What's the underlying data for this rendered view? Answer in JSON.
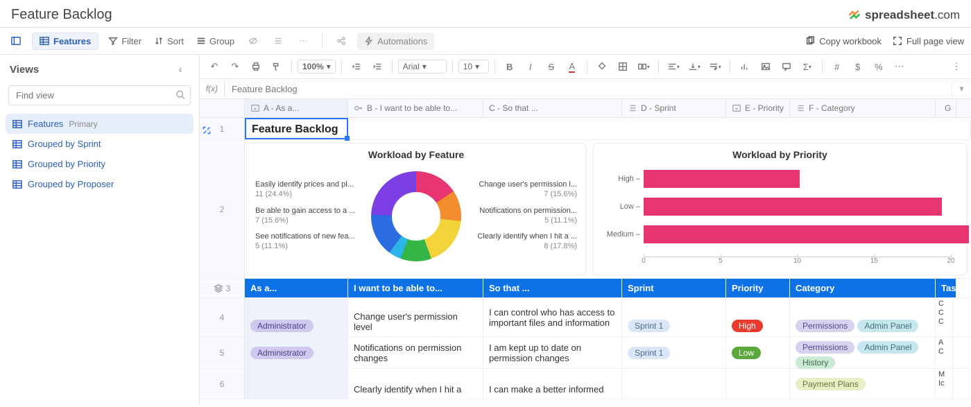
{
  "header": {
    "title": "Feature Backlog",
    "brand_text": "spreadsheet",
    "brand_suffix": ".com",
    "copy_label": "Copy workbook",
    "fullpage_label": "Full page view"
  },
  "toolbar1": {
    "features_tab": "Features",
    "filter": "Filter",
    "sort": "Sort",
    "group": "Group",
    "automations": "Automations"
  },
  "sidebar": {
    "views_label": "Views",
    "search_placeholder": "Find view",
    "items": [
      {
        "label": "Features",
        "primary": "Primary",
        "active": true
      },
      {
        "label": "Grouped by Sprint"
      },
      {
        "label": "Grouped by Priority"
      },
      {
        "label": "Grouped by Proposer"
      }
    ]
  },
  "toolbar2": {
    "zoom": "100%",
    "font": "Arial",
    "size": "10"
  },
  "fx": {
    "label": "f(x)",
    "value": "Feature Backlog"
  },
  "columns": {
    "A": "A - As a...",
    "B": "B - I want to be able to...",
    "C": "C - So that ...",
    "D": "D - Sprint",
    "E": "E - Priority",
    "F": "F - Category",
    "G": "G"
  },
  "rows": {
    "r1": {
      "num": "1",
      "a": "Feature Backlog"
    },
    "r2": {
      "num": "2"
    },
    "r3": {
      "num": "3",
      "A": "As a...",
      "B": "I want to be able to...",
      "C": "So that ...",
      "D": "Sprint",
      "E": "Priority",
      "F": "Category",
      "G": "Tas"
    },
    "r4": {
      "num": "4",
      "A": "Administrator",
      "B": "Change user's permission level",
      "C": "I can control who has access to important files and information",
      "D": "Sprint 1",
      "E": "High",
      "F": [
        "Permissions",
        "Admin Panel"
      ],
      "flags": [
        "C",
        "C",
        "C"
      ]
    },
    "r5": {
      "num": "5",
      "A": "Administrator",
      "B": "Notifications on permission changes",
      "C": "I am kept up to date on permission changes",
      "D": "Sprint 1",
      "E": "Low",
      "F": [
        "Permissions",
        "Admin Panel",
        "History"
      ],
      "flags": [
        "A",
        "C"
      ]
    },
    "r6": {
      "num": "6",
      "B": "Clearly identify when I hit a",
      "C": "I can make a better informed",
      "F": [
        "Payment Plans"
      ],
      "flags": [
        "M",
        "Ic"
      ]
    }
  },
  "chart_data": [
    {
      "type": "pie",
      "title": "Workload by Feature",
      "series": [
        {
          "name": "Change user's permission l...",
          "value": 7,
          "pct": 15.6,
          "color": "#e63570"
        },
        {
          "name": "Notifications on permission...",
          "value": 5,
          "pct": 11.1,
          "color": "#f18d2f"
        },
        {
          "name": "Clearly identify when I hit a ...",
          "value": 8,
          "pct": 17.8,
          "color": "#f2d43a"
        },
        {
          "name": "(green slice)",
          "value": 5,
          "pct": 11.1,
          "color": "#33b646"
        },
        {
          "name": "(cyan slice)",
          "value": 2,
          "pct": 4.4,
          "color": "#2cb5e8"
        },
        {
          "name": "Be able to gain access to a ...",
          "value": 7,
          "pct": 15.6,
          "color": "#2b6de0"
        },
        {
          "name": "Easily identify prices and pl...",
          "value": 11,
          "pct": 24.4,
          "color": "#7b3fe4"
        }
      ],
      "left_labels": [
        {
          "t": "Easily identify prices and pl...",
          "v": "11 (24.4%)"
        },
        {
          "t": "Be able to gain access to a ...",
          "v": "7 (15.6%)"
        },
        {
          "t": "See notifications of new fea...",
          "v": "5 (11.1%)"
        }
      ],
      "right_labels": [
        {
          "t": "Change user's permission l...",
          "v": "7 (15.6%)"
        },
        {
          "t": "Notifications on permission...",
          "v": "5 (11.1%)"
        },
        {
          "t": "Clearly identify when I hit a ...",
          "v": "8 (17.8%)"
        }
      ]
    },
    {
      "type": "bar",
      "title": "Workload by Priority",
      "categories": [
        "High",
        "Low",
        "Medium"
      ],
      "values": [
        9,
        17,
        18.5
      ],
      "xlim": [
        0,
        20
      ],
      "xticks": [
        0,
        5,
        10,
        15,
        20
      ],
      "color": "#e63570"
    }
  ]
}
